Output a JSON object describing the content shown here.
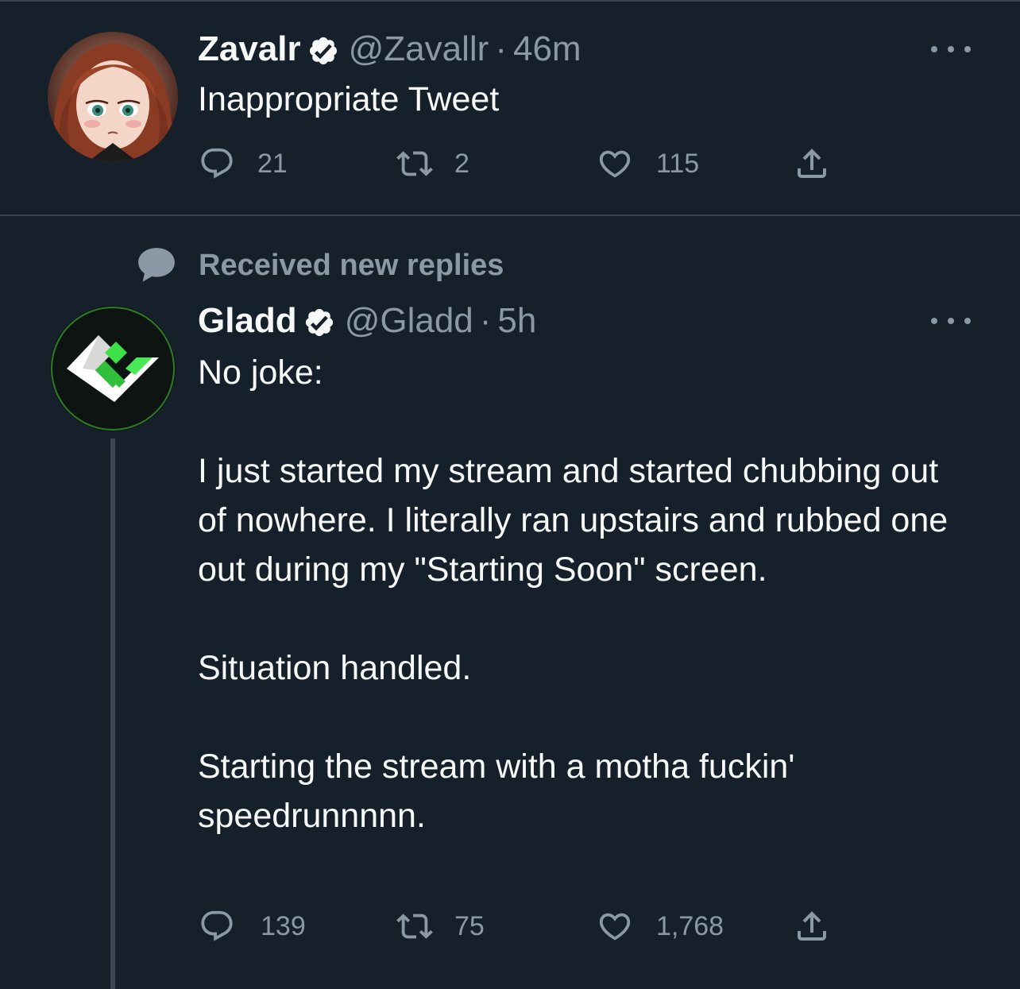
{
  "tweets": [
    {
      "display_name": "Zavalr",
      "handle": "@Zavallr",
      "separator": "·",
      "time": "46m",
      "text": "Inappropriate Tweet",
      "actions": {
        "replies": "21",
        "retweets": "2",
        "likes": "115"
      }
    },
    {
      "display_name": "Gladd",
      "handle": "@Gladd",
      "separator": "·",
      "time": "5h",
      "text": "No joke:\n\nI just started my stream and started chubbing out of nowhere. I literally ran upstairs and rubbed one out during my \"Starting Soon\" screen.\n\nSituation handled.\n\nStarting the stream with a motha fuckin' speedrunnnnn.",
      "actions": {
        "replies": "139",
        "retweets": "75",
        "likes": "1,768"
      }
    }
  ],
  "context": {
    "label": "Received new replies"
  },
  "colors": {
    "background": "#15202b",
    "text": "#f7f9f9",
    "muted": "#8b98a5",
    "divider": "#38444d",
    "brand_green": "#4cd137"
  },
  "icons": {
    "reply": "reply-icon",
    "retweet": "retweet-icon",
    "like": "heart-icon",
    "share": "share-icon",
    "verified": "verified-badge-icon",
    "more": "more-options-icon",
    "context": "speech-bubble-icon"
  }
}
